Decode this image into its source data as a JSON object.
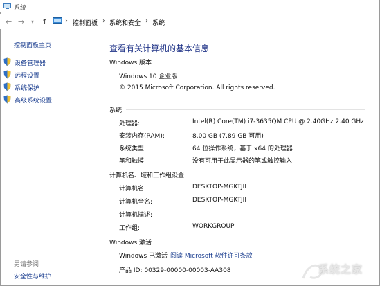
{
  "window": {
    "title": "系统"
  },
  "address_bar": {
    "crumbs": [
      "控制面板",
      "系统和安全",
      "系统"
    ]
  },
  "sidebar": {
    "home": "控制面板主页",
    "items": [
      {
        "label": "设备管理器",
        "icon": "shield-icon"
      },
      {
        "label": "远程设置",
        "icon": "shield-icon"
      },
      {
        "label": "系统保护",
        "icon": "shield-icon"
      },
      {
        "label": "高级系统设置",
        "icon": "shield-icon"
      }
    ],
    "see_also_title": "另请参阅",
    "see_also_items": [
      "安全性与维护"
    ]
  },
  "main": {
    "title": "查看有关计算机的基本信息",
    "edition": {
      "heading": "Windows 版本",
      "name": "Windows 10 企业版",
      "copyright": "© 2015 Microsoft Corporation. All rights reserved."
    },
    "system": {
      "heading": "系统",
      "rows": [
        {
          "label": "处理器:",
          "value": "Intel(R) Core(TM) i7-3635QM CPU @ 2.40GHz   2.40 GHz"
        },
        {
          "label": "安装内存(RAM):",
          "value": "8.00 GB (7.89 GB 可用)"
        },
        {
          "label": "系统类型:",
          "value": "64 位操作系统，基于 x64 的处理器"
        },
        {
          "label": "笔和触摸:",
          "value": "没有可用于此显示器的笔或触控输入"
        }
      ]
    },
    "computer": {
      "heading": "计算机名、域和工作组设置",
      "rows": [
        {
          "label": "计算机名:",
          "value": "DESKTOP-MGKTJII"
        },
        {
          "label": "计算机全名:",
          "value": "DESKTOP-MGKTJII"
        },
        {
          "label": "计算机描述:",
          "value": ""
        },
        {
          "label": "工作组:",
          "value": "WORKGROUP"
        }
      ]
    },
    "activation": {
      "heading": "Windows 激活",
      "status": "Windows 已激活",
      "license_link": "阅读 Microsoft 软件许可条款",
      "product_id": "产品 ID: 00329-00000-00003-AA308"
    }
  },
  "watermark": {
    "text": "系统之家"
  },
  "colors": {
    "link": "#1a3d8f",
    "title": "#1e3287"
  }
}
